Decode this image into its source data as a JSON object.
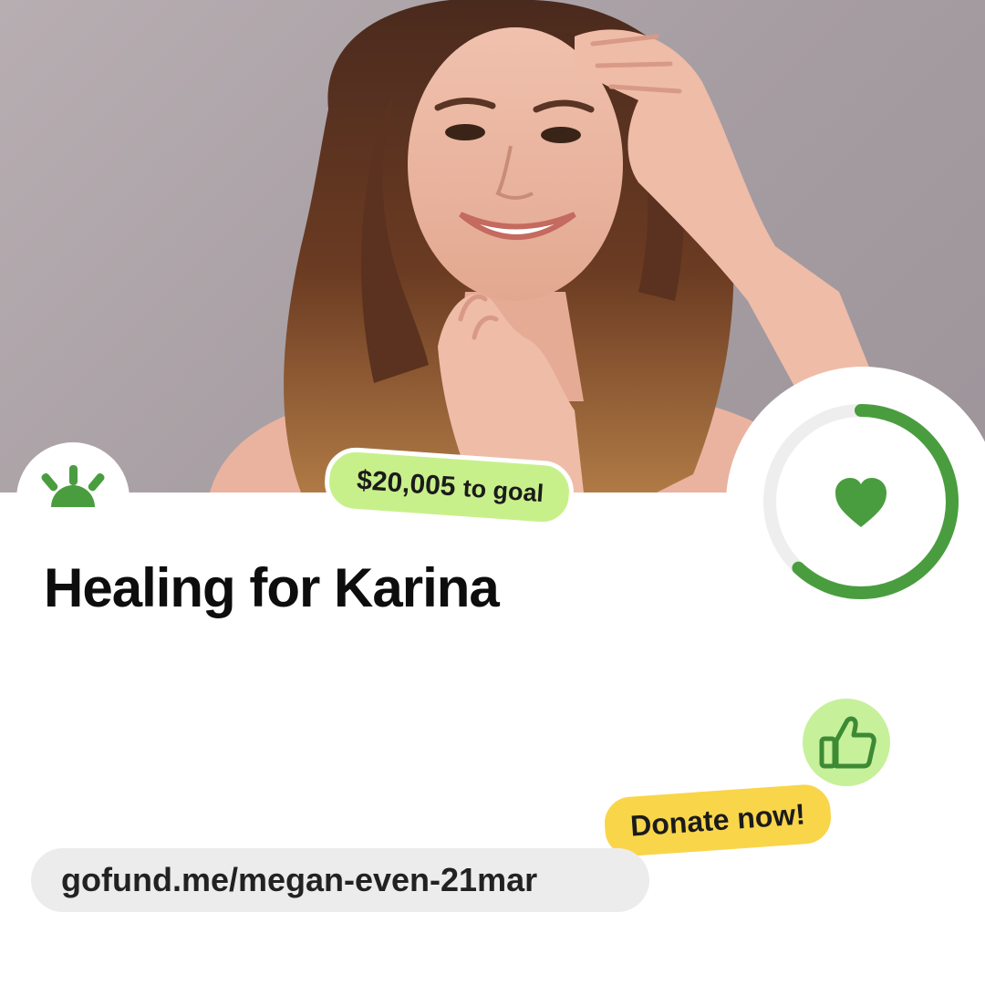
{
  "photo": {
    "subject": "Smiling woman with long wavy brown and blonde hair, hand raised to her forehead"
  },
  "brand": {
    "logo_icon": "gofundme-sunrise-icon",
    "color_green": "#4a9d3f",
    "color_lime": "#c8f08a",
    "color_yellow": "#f9d54a"
  },
  "goal": {
    "label": "$20,005 to goal",
    "amount": "$20,005",
    "suffix": "to goal"
  },
  "campaign": {
    "title": "Healing for Karina"
  },
  "progress": {
    "fraction": 0.62,
    "icon": "heart-icon"
  },
  "cta": {
    "icon": "thumbs-up-icon",
    "donate_label": "Donate now!"
  },
  "url": {
    "text": "gofund.me/megan-even-21mar"
  }
}
